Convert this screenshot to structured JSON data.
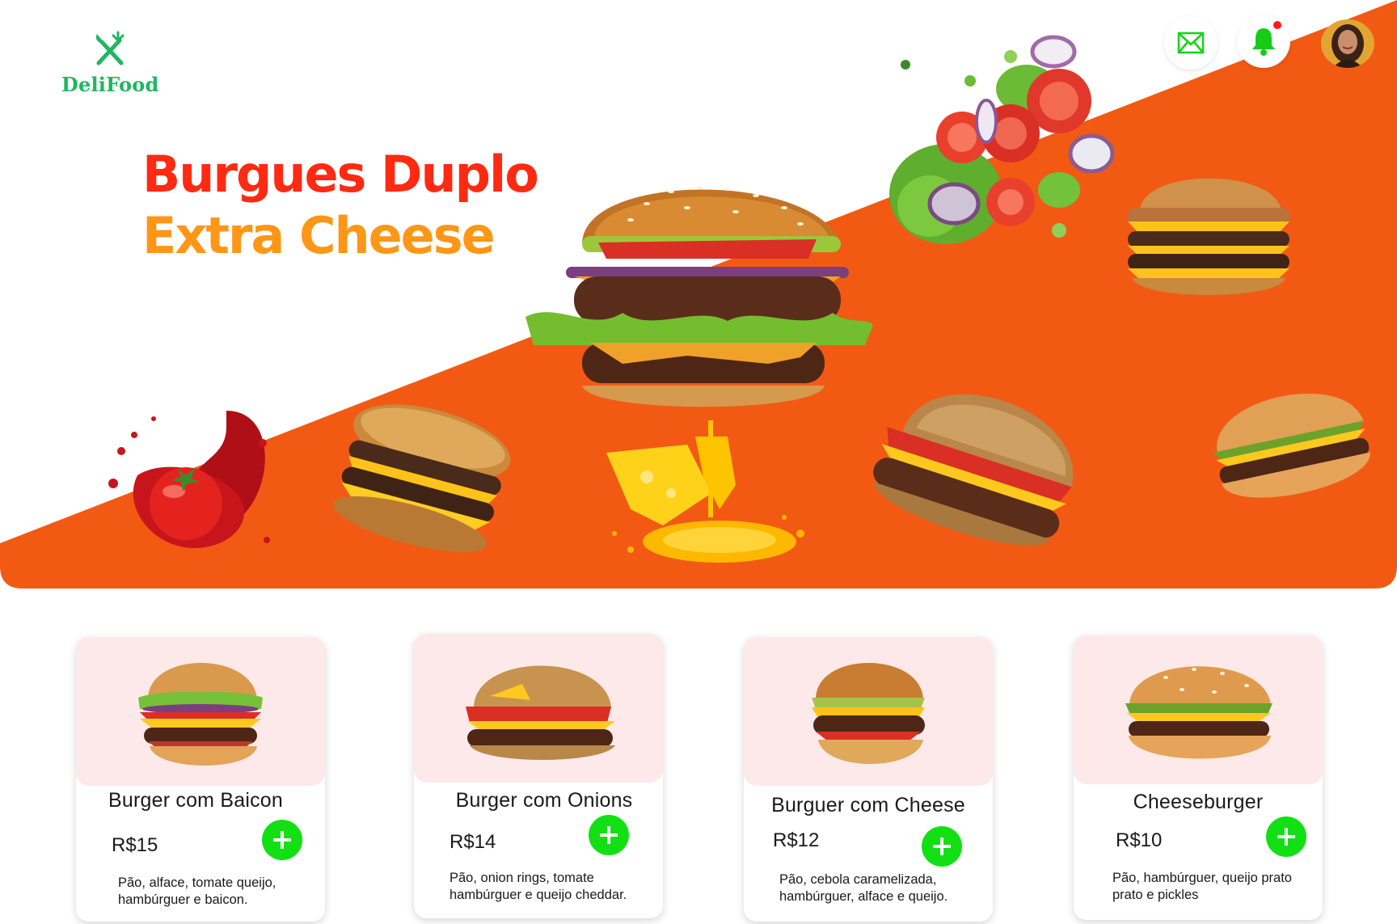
{
  "brand": {
    "name": "DeliFood",
    "color": "#1fb75f"
  },
  "header": {
    "mail_icon": "mail-icon",
    "bell_icon": "bell-icon",
    "has_notification": true,
    "avatar": "user-avatar"
  },
  "hero": {
    "title_line1": "Burgues Duplo",
    "title_line2": "Extra Cheese",
    "accent_color": "#f25a14"
  },
  "products": [
    {
      "name": "Burger com Baicon",
      "price": "R$15",
      "description": "Pão, alface, tomate queijo, hambúrguer e baicon."
    },
    {
      "name": "Burger com Onions",
      "price": "R$14",
      "description": "Pão, onion rings, tomate hambúrguer e queijo cheddar."
    },
    {
      "name": "Burguer com Cheese",
      "price": "R$12",
      "description": "Pão, cebola caramelizada, hambúrguer, alface e queijo."
    },
    {
      "name": "Cheeseburger",
      "price": "R$10",
      "description": "Pão, hambúrguer, queijo prato prato e pickles"
    }
  ]
}
